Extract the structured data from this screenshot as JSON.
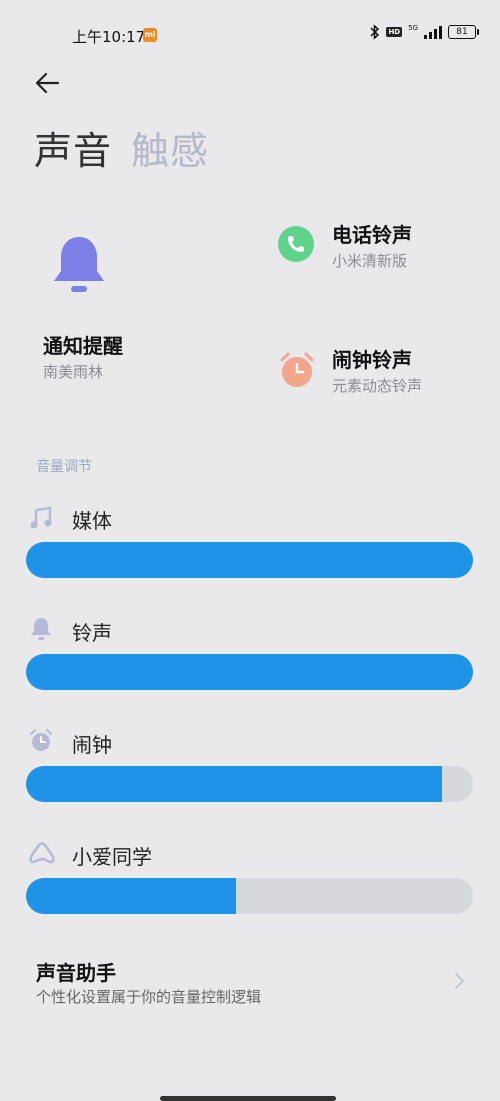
{
  "status_bar": {
    "time": "上午10:17",
    "mi_badge": "mi",
    "hd": "HD",
    "network": "5G",
    "battery": "81"
  },
  "header": {
    "back_icon": "arrow-left-icon",
    "tabs": [
      {
        "label": "声音",
        "active": true
      },
      {
        "label": "触感",
        "active": false
      }
    ]
  },
  "sound_cards": {
    "notification": {
      "title": "通知提醒",
      "subtitle": "南美雨林",
      "icon": "bell-icon",
      "color": "#7d7fe6"
    },
    "ringtone": {
      "title": "电话铃声",
      "subtitle": "小米清新版",
      "icon": "phone-icon",
      "color": "#5fd38a"
    },
    "alarm": {
      "title": "闹钟铃声",
      "subtitle": "元素动态铃声",
      "icon": "alarm-clock-icon",
      "color": "#f2a68a"
    }
  },
  "volume": {
    "section_label": "音量调节",
    "items": [
      {
        "label": "媒体",
        "icon": "music-note-icon",
        "level": 1.0
      },
      {
        "label": "铃声",
        "icon": "bell-icon",
        "level": 1.0
      },
      {
        "label": "闹钟",
        "icon": "alarm-clock-icon",
        "level": 0.93
      },
      {
        "label": "小爱同学",
        "icon": "xiaoai-icon",
        "level": 0.47
      }
    ],
    "fill_color": "#1e93e8"
  },
  "assistant": {
    "title": "声音助手",
    "subtitle": "个性化设置属于你的音量控制逻辑"
  }
}
